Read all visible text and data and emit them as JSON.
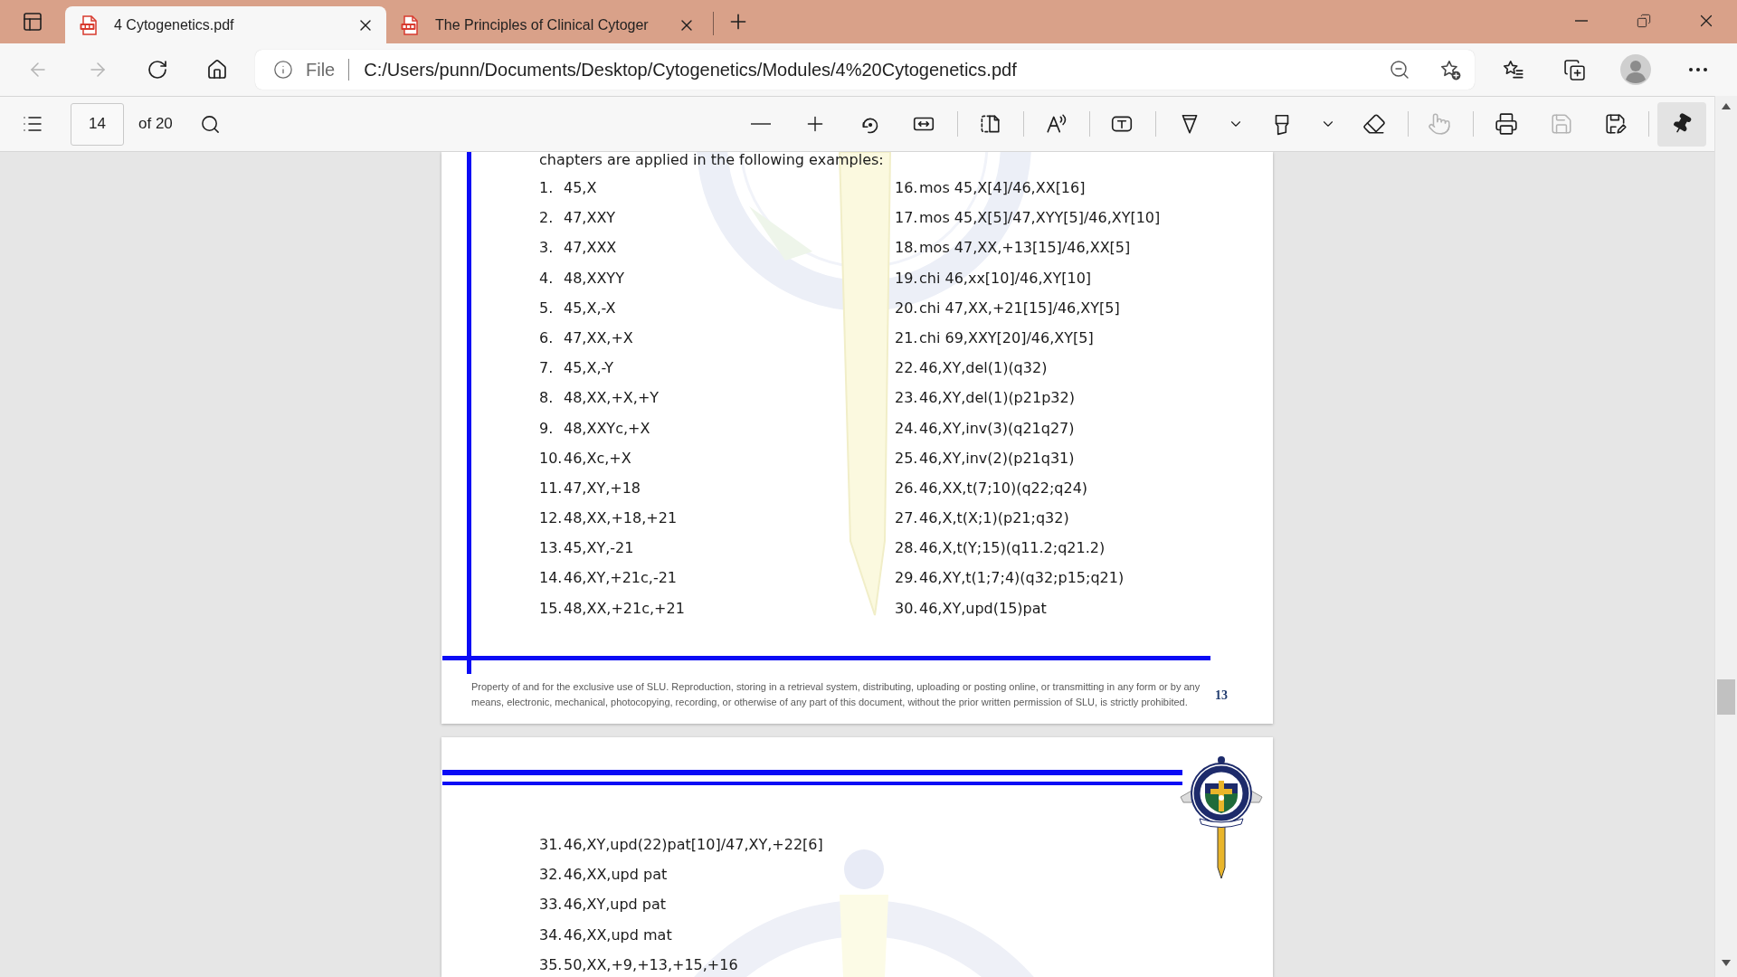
{
  "tabs": [
    {
      "title": "4 Cytogenetics.pdf",
      "selected": true
    },
    {
      "title": "The Principles of Clinical Cytoger",
      "selected": false
    }
  ],
  "navigation": {
    "back": {
      "disabled": true
    },
    "forward": {
      "disabled": true
    }
  },
  "address_bar": {
    "site_label": "File",
    "url": "C:/Users/punn/Documents/Desktop/Cytogenetics/Modules/4%20Cytogenetics.pdf"
  },
  "pdf_toolbar": {
    "page_number": "14",
    "page_count": "of 20",
    "touch_button": {
      "disabled": true
    },
    "save_button": {
      "disabled": true
    },
    "pin_button": {
      "on": true
    }
  },
  "pages": [
    {
      "intro": "chapters are applied in the following examples:",
      "columns": [
        [
          {
            "number": "1.",
            "text": "45,X"
          },
          {
            "number": "2.",
            "text": "47,XXY"
          },
          {
            "number": "3.",
            "text": "47,XXX"
          },
          {
            "number": "4.",
            "text": "48,XXYY"
          },
          {
            "number": "5.",
            "text": "45,X,-X"
          },
          {
            "number": "6.",
            "text": "47,XX,+X"
          },
          {
            "number": "7.",
            "text": "45,X,-Y"
          },
          {
            "number": "8.",
            "text": "48,XX,+X,+Y"
          },
          {
            "number": "9.",
            "text": "48,XXYc,+X"
          },
          {
            "number": "10.",
            "text": "46,Xc,+X"
          },
          {
            "number": "11.",
            "text": "47,XY,+18"
          },
          {
            "number": "12.",
            "text": "48,XX,+18,+21"
          },
          {
            "number": "13.",
            "text": "45,XY,-21"
          },
          {
            "number": "14.",
            "text": "46,XY,+21c,-21"
          },
          {
            "number": "15.",
            "text": "48,XX,+21c,+21"
          }
        ],
        [
          {
            "number": "16.",
            "text": "mos 45,X[4]/46,XX[16]"
          },
          {
            "number": "17.",
            "text": "mos 45,X[5]/47,XYY[5]/46,XY[10]"
          },
          {
            "number": "18.",
            "text": "mos 47,XX,+13[15]/46,XX[5]"
          },
          {
            "number": "19.",
            "text": "chi 46,xx[10]/46,XY[10]"
          },
          {
            "number": "20.",
            "text": "chi 47,XX,+21[15]/46,XY[5]"
          },
          {
            "number": "21.",
            "text": "chi 69,XXY[20]/46,XY[5]"
          },
          {
            "number": "22.",
            "text": "46,XY,del(1)(q32)"
          },
          {
            "number": "23.",
            "text": "46,XY,del(1)(p21p32)"
          },
          {
            "number": "24.",
            "text": "46,XY,inv(3)(q21q27)"
          },
          {
            "number": "25.",
            "text": "46,XY,inv(2)(p21q31)"
          },
          {
            "number": "26.",
            "text": "46,XX,t(7;10)(q22;q24)"
          },
          {
            "number": "27.",
            "text": "46,X,t(X;1)(p21;q32)"
          },
          {
            "number": "28.",
            "text": "46,X,t(Y;15)(q11.2;q21.2)"
          },
          {
            "number": "29.",
            "text": "46,XY,t(1;7;4)(q32;p15;q21)"
          },
          {
            "number": "30.",
            "text": "46,XY,upd(15)pat"
          }
        ]
      ],
      "footer": "Property of and for the exclusive use of SLU. Reproduction, storing in a retrieval system, distributing, uploading or posting online, or transmitting in any form or by any means, electronic, mechanical, photocopying, recording, or otherwise of any part of this document, without the prior written permission of SLU, is strictly prohibited.",
      "page_number": "13"
    },
    {
      "items": [
        {
          "number": "31.",
          "text": "46,XY,upd(22)pat[10]/47,XY,+22[6]"
        },
        {
          "number": "32.",
          "text": "46,XX,upd pat"
        },
        {
          "number": "33.",
          "text": "46,XY,upd pat"
        },
        {
          "number": "34.",
          "text": "46,XX,upd mat"
        },
        {
          "number": "35.",
          "text": "50,XX,+9,+13,+15,+16"
        }
      ]
    }
  ]
}
